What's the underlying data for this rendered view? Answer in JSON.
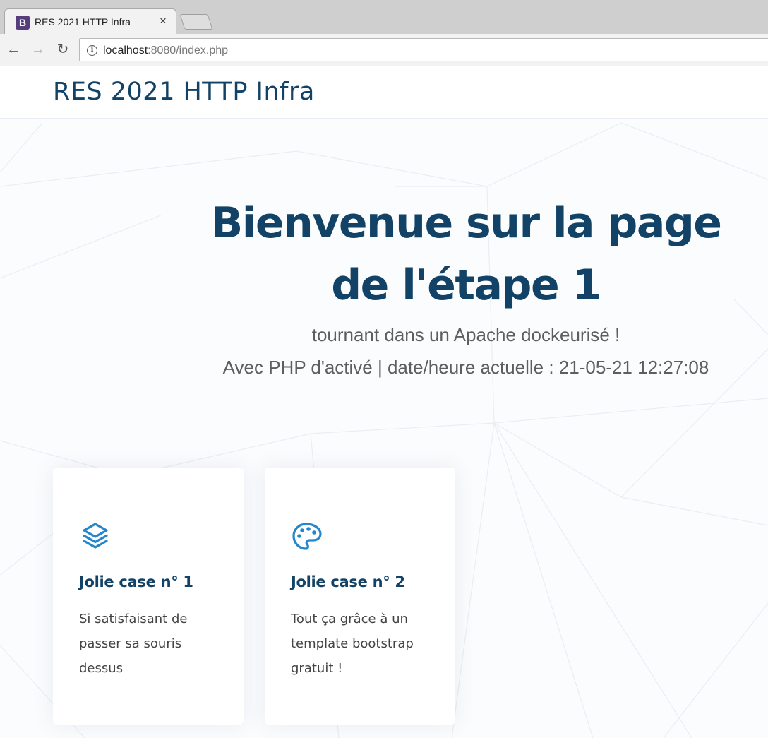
{
  "browser": {
    "tab_title": "RES 2021 HTTP Infra",
    "favicon_letter": "B",
    "close_glyph": "×",
    "url_host": "localhost",
    "url_rest": ":8080/index.php",
    "back_glyph": "←",
    "forward_glyph": "→",
    "reload_glyph": "↻",
    "info_glyph": "i"
  },
  "navbar": {
    "brand": "RES 2021 HTTP Infra"
  },
  "hero": {
    "title_line1": "Bienvenue sur la page",
    "title_line2": "de l'étape 1",
    "subtitle": "tournant dans un Apache dockeurisé !",
    "php_line": "Avec PHP d'activé | date/heure actuelle : 21-05-21 12:27:08"
  },
  "cards": [
    {
      "icon": "layers-icon",
      "title": "Jolie case n° 1",
      "text": "Si satisfaisant de passer sa souris dessus"
    },
    {
      "icon": "palette-icon",
      "title": "Jolie case n° 2",
      "text": "Tout ça grâce à un template bootstrap gratuit !"
    }
  ],
  "colors": {
    "heading": "#124265",
    "accent": "#2487ce",
    "body_text": "#444444",
    "favicon": "#563d7c"
  }
}
